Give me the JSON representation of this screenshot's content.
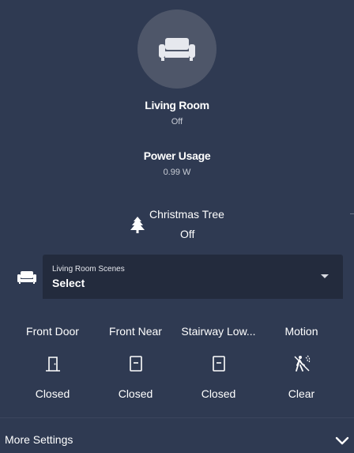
{
  "room": {
    "name": "Living Room",
    "state": "Off",
    "icon": "sofa-icon"
  },
  "power": {
    "title": "Power Usage",
    "value": "0.99 W"
  },
  "tree": {
    "name": "Christmas Tree",
    "state": "Off",
    "icon": "pine-tree-icon"
  },
  "scenes": {
    "label": "Living Room Scenes",
    "value": "Select",
    "icon": "sofa-icon"
  },
  "sensors": [
    {
      "name": "Front Door",
      "state": "Closed",
      "icon": "door-closed-icon"
    },
    {
      "name": "Front Near",
      "state": "Closed",
      "icon": "window-closed-icon"
    },
    {
      "name": "Stairway Low...",
      "state": "Closed",
      "icon": "window-closed-icon"
    },
    {
      "name": "Motion",
      "state": "Clear",
      "icon": "motion-sensor-off-icon"
    }
  ],
  "more_settings": {
    "label": "More Settings"
  },
  "colors": {
    "background": "#2f3a52",
    "icon_circle": "#4e5669",
    "select_background": "#232b3d",
    "text": "#ffffff"
  }
}
